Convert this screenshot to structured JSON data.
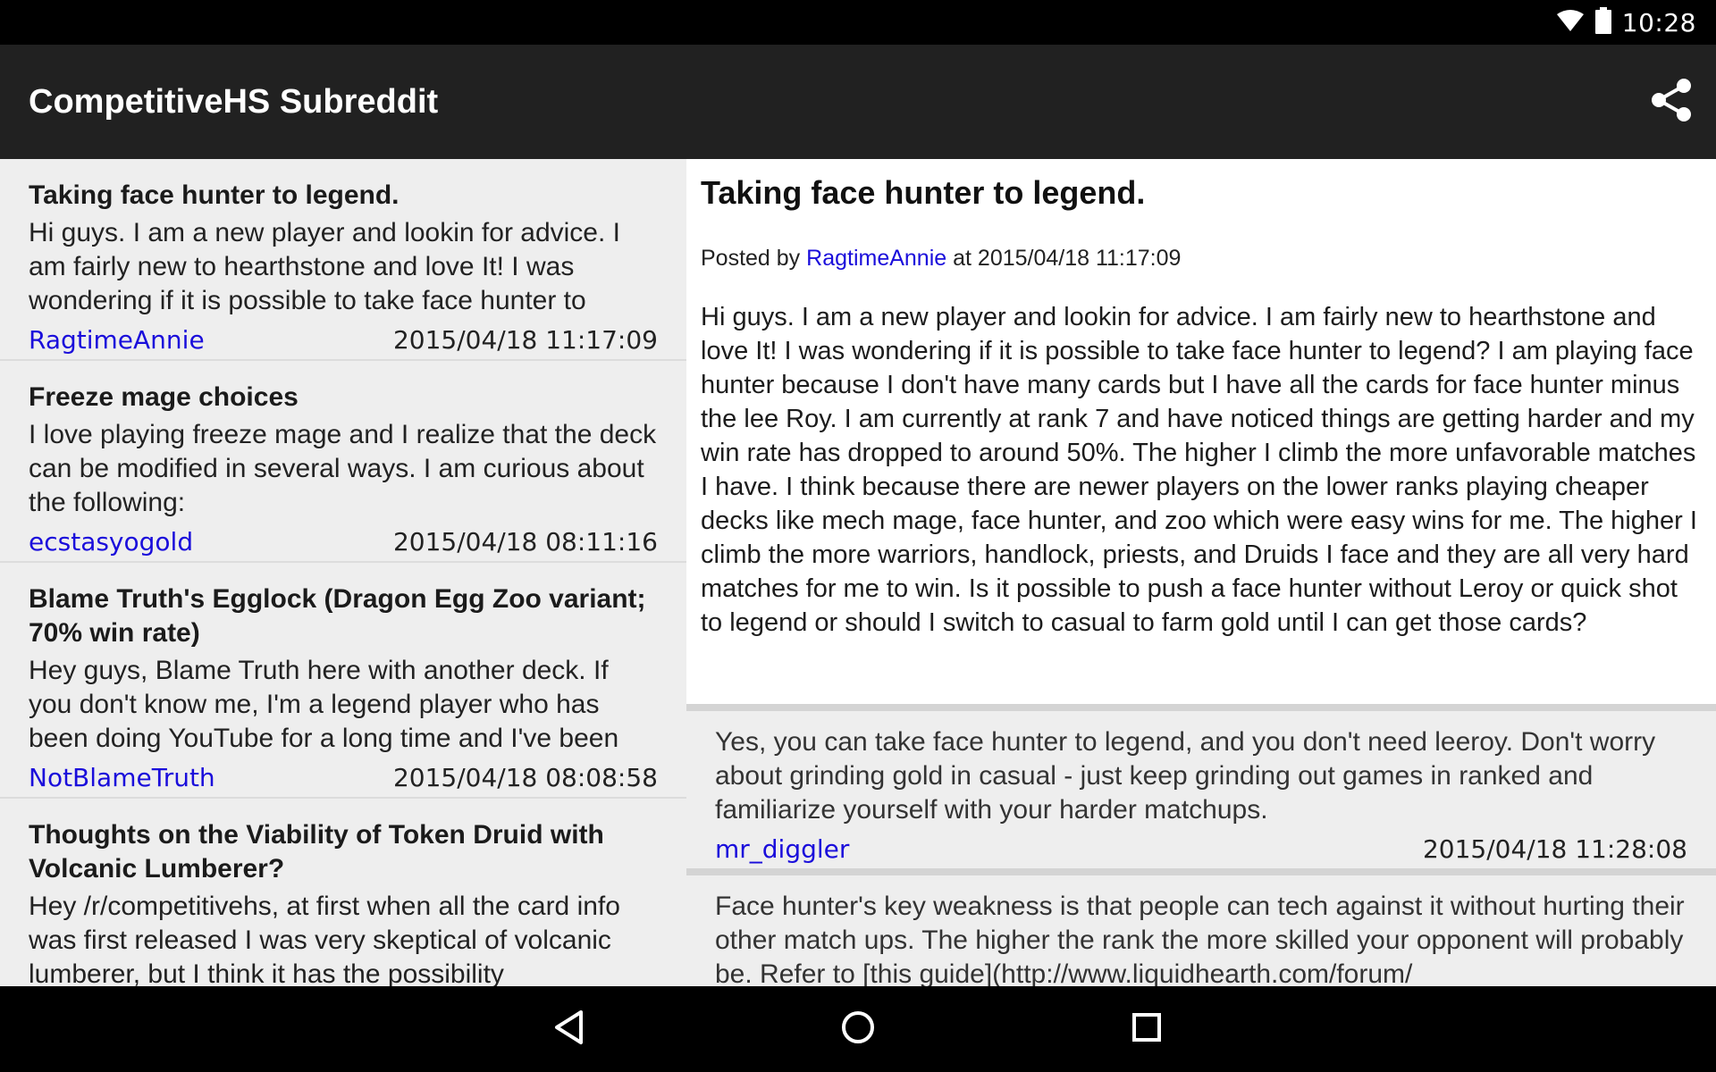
{
  "status_bar": {
    "time": "10:28",
    "icons": [
      "wifi-icon",
      "battery-icon"
    ]
  },
  "app_bar": {
    "title": "CompetitiveHS Subreddit",
    "share_icon": "share-icon"
  },
  "posts": [
    {
      "title": "Taking face hunter to legend.",
      "excerpt": "Hi guys. I am a new player and lookin for advice. I am fairly new to hearthstone and love It!  I was wondering if it is possible to take face hunter to",
      "author": "RagtimeAnnie",
      "date": "2015/04/18 11:17:09"
    },
    {
      "title": "Freeze mage choices",
      "excerpt": "I love playing freeze mage and I realize that the deck can be modified in several ways. I am curious about the following:",
      "author": "ecstasyogold",
      "date": "2015/04/18 08:11:16"
    },
    {
      "title": "Blame Truth's Egglock (Dragon Egg Zoo variant; 70% win rate)",
      "excerpt": "Hey guys, Blame Truth here with another deck. If you don't know me, I'm a legend player who has been doing YouTube for a long time and I've been",
      "author": "NotBlameTruth",
      "date": "2015/04/18 08:08:58"
    },
    {
      "title": "Thoughts on the Viability of Token Druid with Volcanic Lumberer?",
      "excerpt": "Hey /r/competitivehs, at first when all the card info was first released I was very skeptical of volcanic lumberer, but I think it has the possibility",
      "author": "",
      "date": ""
    }
  ],
  "detail": {
    "title": "Taking face hunter to legend.",
    "posted_by_prefix": "Posted by ",
    "author": "RagtimeAnnie",
    "at_text": " at 2015/04/18 11:17:09",
    "body": "Hi guys. I am a new player and lookin for advice. I am fairly new to hearthstone and love It! I was wondering if it is possible to take face hunter to legend? I am playing face hunter because I don't have many cards but I have all the cards for face hunter minus the lee Roy. I am currently at rank 7 and have noticed things are getting harder and my win rate has dropped to around 50%. The higher I climb the more unfavorable matches I have. I think because there are newer players on the lower ranks playing cheaper decks like mech mage, face hunter, and zoo which were easy wins for me. The higher I climb the more warriors, handlock, priests, and Druids I face and they are all very hard matches for me to win. Is it possible to push a face hunter without Leroy or quick shot to legend or should I switch to casual to farm gold until I can get those cards?"
  },
  "comments": [
    {
      "text": "Yes, you can take face hunter to legend, and you don't need leeroy. Don't worry about grinding gold in casual - just keep grinding out games in ranked and familiarize yourself with your harder matchups.",
      "author": "mr_diggler",
      "date": "2015/04/18 11:28:08"
    },
    {
      "text": "Face hunter's key weakness is that people can tech against it without hurting their other match ups. The higher the rank the more skilled your opponent will probably be. Refer to [this guide](http://www.liquidhearth.com/forum/",
      "author": "",
      "date": ""
    }
  ],
  "nav_bar": {
    "icons": [
      "back-icon",
      "home-icon",
      "recents-icon"
    ]
  }
}
